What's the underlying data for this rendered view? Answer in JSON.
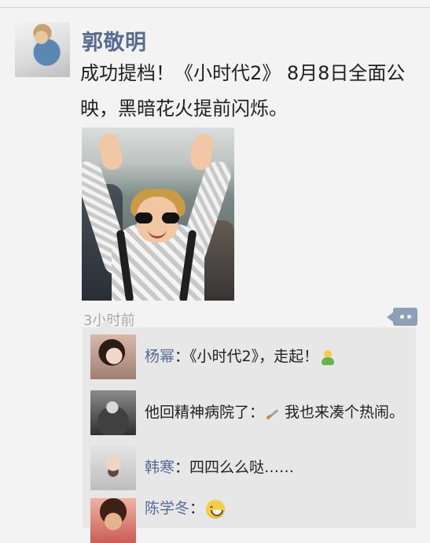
{
  "post": {
    "author": "郭敬明",
    "text": "成功提档！《小时代2》 8月8日全面公映，黑暗花火提前闪烁。",
    "time": "3小时前"
  },
  "comments": [
    {
      "name": "杨幂",
      "content": "：《小时代2》，走起！",
      "emoji": "green-person-emoji-icon"
    },
    {
      "name": "",
      "content": "他回精神病院了：",
      "emoji": "knife-emoji-icon",
      "suffix": " 我也来凑个热闹。"
    },
    {
      "name": "韩寒",
      "content": "：四四么么哒……",
      "emoji": "",
      "suffix": ""
    },
    {
      "name": "陈学冬",
      "content": "：",
      "emoji": "laugh-emoji-icon",
      "suffix": ""
    }
  ],
  "colors": {
    "name_link": "#576b95",
    "timestamp": "#a9a9a9",
    "comment_bg": "#e7e7e7",
    "comment_toggle": "#8ea0b7",
    "page_bg": "#f3f3f3"
  }
}
